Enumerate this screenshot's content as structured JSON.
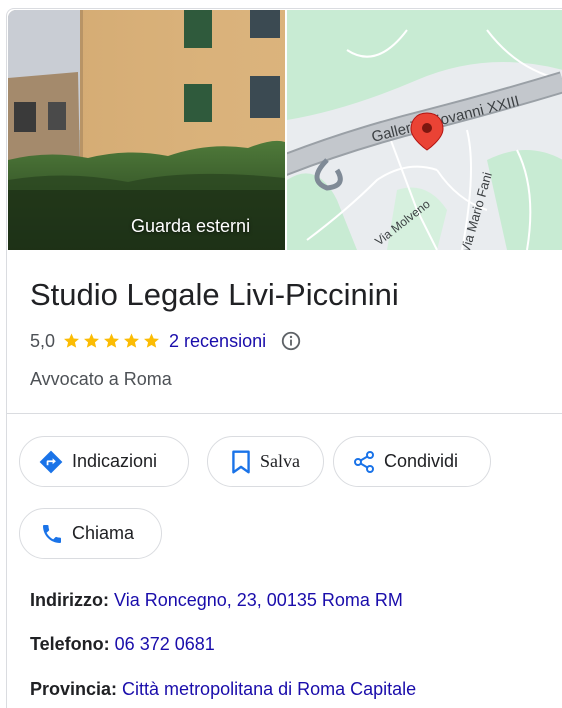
{
  "header": {
    "photo_label": "Guarda esterni",
    "map_labels": {
      "road_main": "Galleria Giovanni XXIII",
      "road_left": "Via Molveno",
      "road_right": "Via Mario Fani"
    }
  },
  "business": {
    "name": "Studio Legale Livi-Piccinini",
    "rating_value": "5,0",
    "star_count": 5,
    "reviews_label": "2 recensioni",
    "category": "Avvocato a Roma"
  },
  "actions": {
    "directions": "Indicazioni",
    "save": "Salva",
    "share": "Condividi",
    "call": "Chiama"
  },
  "details": {
    "address": {
      "key": "Indirizzo:",
      "value": "Via Roncegno, 23, 00135 Roma RM"
    },
    "phone": {
      "key": "Telefono:",
      "value": "06 372 0681"
    },
    "province": {
      "key": "Provincia:",
      "value": "Città metropolitana di Roma Capitale"
    }
  },
  "icons": {
    "directions": "directions-icon",
    "save": "bookmark-icon",
    "share": "share-icon",
    "call": "phone-icon",
    "info": "info-icon",
    "pin": "map-pin-icon",
    "star": "star-icon"
  },
  "colors": {
    "accent_blue": "#1a73e8",
    "link": "#1a0dab",
    "star": "#fbbc04",
    "pin": "#ea4335",
    "map_green": "#c8ebd3"
  }
}
